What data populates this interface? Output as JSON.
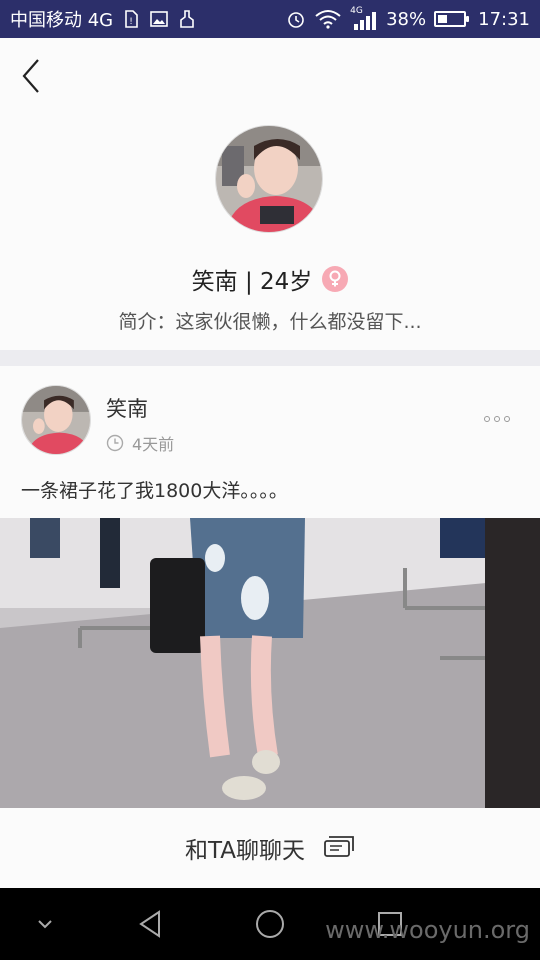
{
  "status_bar": {
    "carrier": "中国移动 4G",
    "battery_text": "38%",
    "battery_level": 0.38,
    "time": "17:31",
    "signal_label": "4G",
    "icons": [
      "sim-alert-icon",
      "image-icon",
      "cleaner-icon",
      "alarm-icon",
      "wifi-icon",
      "signal-icon",
      "battery-icon"
    ]
  },
  "profile": {
    "back_icon": "chevron-left-icon",
    "name_age": "笑南 | 24岁",
    "gender_icon": "female-icon",
    "bio": "简介：这家伙很懒，什么都没留下..."
  },
  "post": {
    "author": "笑南",
    "time": "4天前",
    "text": "一条裙子花了我1800大洋。。。。",
    "more_icon": "more-dots-icon"
  },
  "chat": {
    "label": "和TA聊聊天",
    "icon": "chat-bubble-icon"
  },
  "nav": {
    "icons": [
      "collapse-icon",
      "back-triangle-icon",
      "home-circle-icon",
      "recents-square-icon"
    ]
  },
  "watermark": "www.wooyun.org",
  "colors": {
    "status_bar": "#2c2f6a",
    "gender_badge": "#f7a9b4",
    "divider": "#ececf0"
  }
}
